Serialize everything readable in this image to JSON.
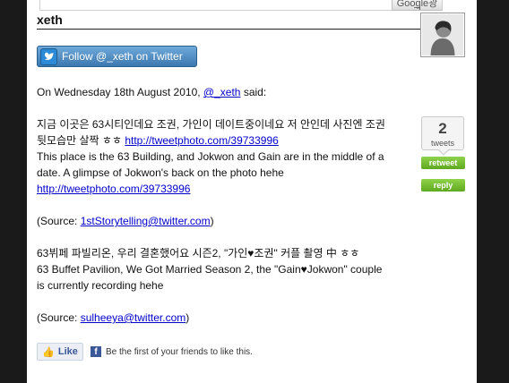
{
  "header": {
    "google_ad_label": "Google광고"
  },
  "profile": {
    "username": "xeth",
    "follow_label": "Follow @_xeth on Twitter"
  },
  "post": {
    "intro_prefix": "On Wednesday 18th August 2010,",
    "intro_handle": "@_xeth",
    "intro_suffix": "said:",
    "korean_1": "지금 이곳은 63시티인데요 조권, 가인이 데이트중이네요 저 안인데 사진엔 조권 뒷모습만 살짝 ㅎㅎ",
    "link_1": "http://tweetphoto.com/39733996",
    "english_1": "This place is the 63 Building, and Jokwon and Gain are in the middle of a date. A glimpse of Jokwon's back on the photo hehe",
    "link_2": "http://tweetphoto.com/39733996",
    "source_1_prefix": "(Source:",
    "source_1_link": "1stStorytelling@twitter.com",
    "source_1_suffix": ")",
    "korean_2": "63뷔페 파빌리온, 우리 결혼했어요 시즌2, \"가인♥조권\" 커플 촬영 中 ㅎㅎ",
    "english_2": "63 Buffet Pavilion, We Got Married Season 2, the \"Gain♥Jokwon\" couple is currently recording hehe",
    "source_2_prefix": "(Source:",
    "source_2_link": "sulheeya@twitter.com",
    "source_2_suffix": ")"
  },
  "tweet_widget": {
    "count": "2",
    "count_label": "tweets",
    "retweet_label": "retweet",
    "reply_label": "reply"
  },
  "facebook": {
    "like_label": "Like",
    "social_text": "Be the first of your friends to like this."
  },
  "colors": {
    "link": "#0000cc",
    "twitter_button": "#3c78b0",
    "green_button": "#6bb62a",
    "facebook_blue": "#3b5998"
  }
}
